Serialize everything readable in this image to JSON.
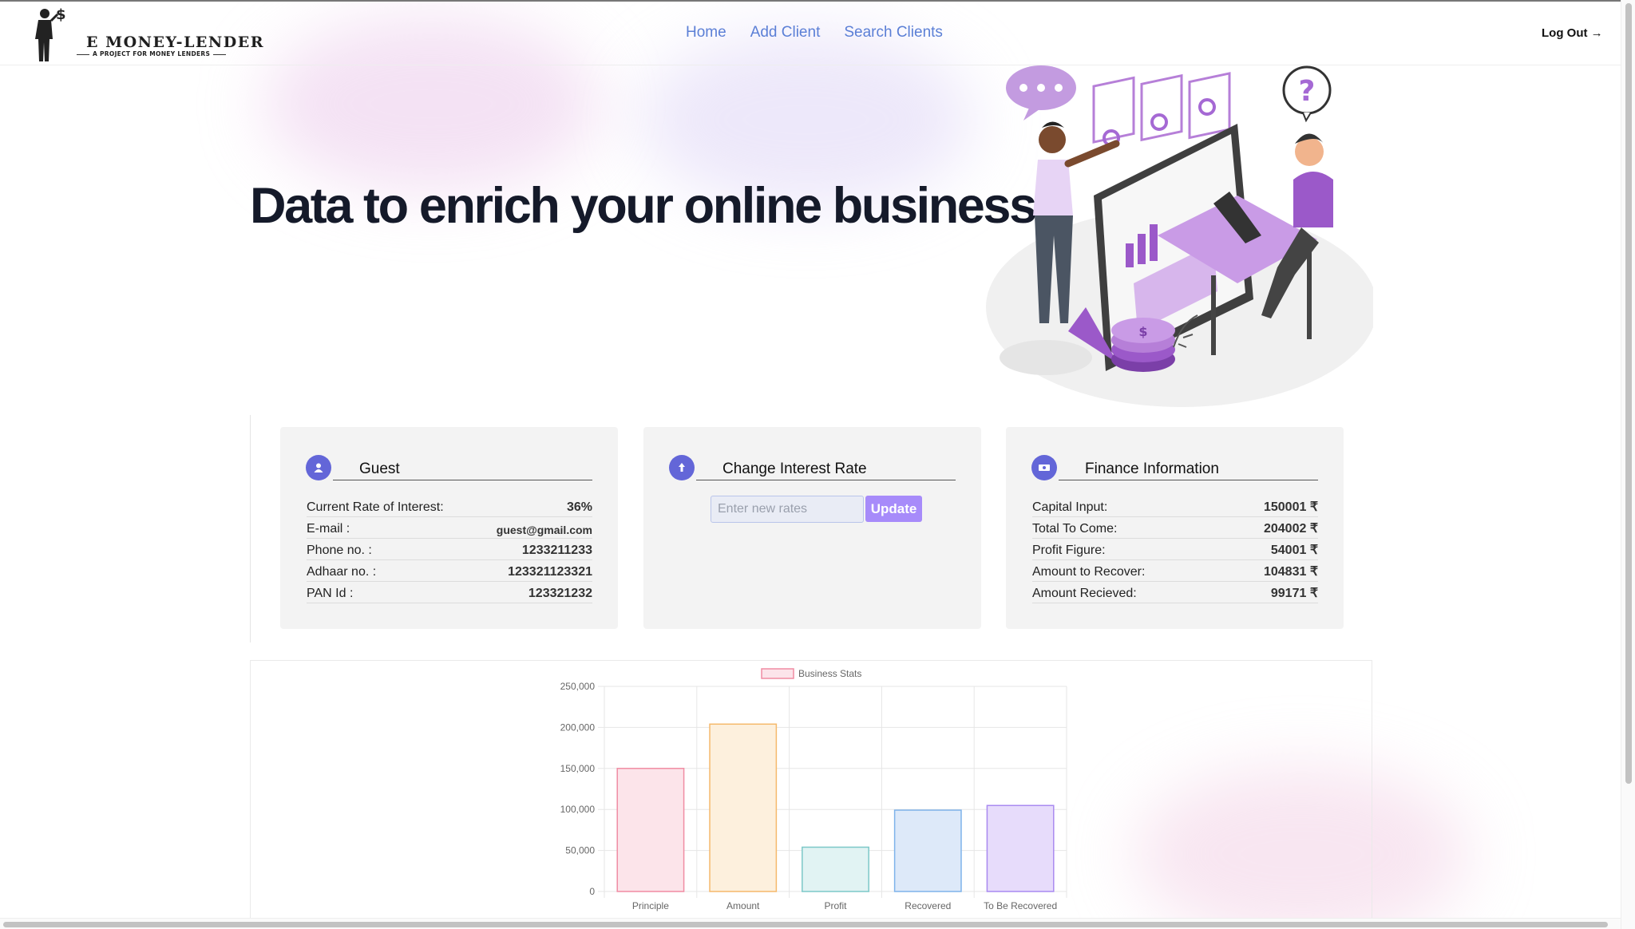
{
  "brand": {
    "title": "E MONEY-LENDER",
    "subtitle": "A PROJECT FOR MONEY LENDERS"
  },
  "nav": {
    "links": [
      "Home",
      "Add Client",
      "Search Clients"
    ],
    "logout": "Log Out →"
  },
  "hero": {
    "title": "Data to enrich your online business"
  },
  "profile": {
    "title": "Guest",
    "rows": [
      {
        "label": "Current Rate of Interest:",
        "value": "36%"
      },
      {
        "label": "E-mail :",
        "value": "guest@gmail.com"
      },
      {
        "label": "Phone no. :",
        "value": "1233211233"
      },
      {
        "label": "Adhaar no. :",
        "value": "123321123321"
      },
      {
        "label": "PAN Id :",
        "value": "123321232"
      }
    ]
  },
  "interest": {
    "title": "Change Interest Rate",
    "placeholder": "Enter new rates",
    "button": "Update"
  },
  "finance": {
    "title": "Finance Information",
    "rows": [
      {
        "label": "Capital Input:",
        "value": "150001 ₹"
      },
      {
        "label": "Total To Come:",
        "value": "204002 ₹"
      },
      {
        "label": "Profit Figure:",
        "value": "54001 ₹"
      },
      {
        "label": "Amount to Recover:",
        "value": "104831 ₹"
      },
      {
        "label": "Amount Recieved:",
        "value": "99171 ₹"
      }
    ]
  },
  "colors": {
    "accent": "#6366d8",
    "link": "#5b7fd6",
    "button": "#a78bfa"
  },
  "chart_data": {
    "type": "bar",
    "categories": [
      "Principle",
      "Amount",
      "Profit",
      "Recovered",
      "To Be Recovered"
    ],
    "series": [
      {
        "name": "Business Stats",
        "values": [
          150001,
          204002,
          54001,
          99171,
          104831
        ]
      }
    ],
    "bar_fills": [
      "#fce4ea",
      "#fdf0dd",
      "#e1f3f3",
      "#dde9f9",
      "#e7dcfb"
    ],
    "bar_strokes": [
      "#f08ca3",
      "#f5b96c",
      "#7cc8c8",
      "#7fb3ea",
      "#a98af0"
    ],
    "ylim": [
      0,
      250000
    ],
    "yticks": [
      "0",
      "50,000",
      "100,000",
      "150,000",
      "200,000",
      "250,000"
    ],
    "legend": "top",
    "grid": true
  }
}
